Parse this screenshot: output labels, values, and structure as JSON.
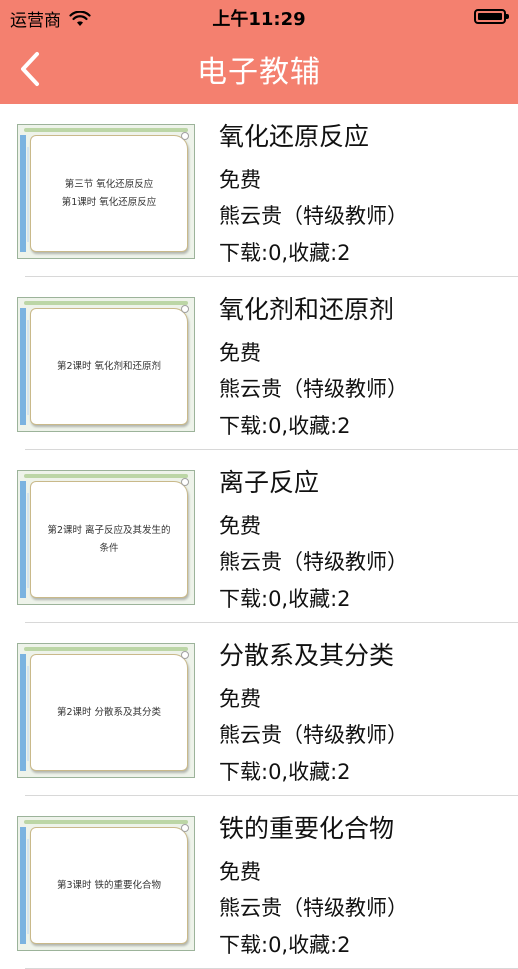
{
  "status_bar": {
    "carrier": "运营商",
    "time": "上午11:29",
    "wifi_icon": "wifi-icon",
    "battery_icon": "battery-icon"
  },
  "nav": {
    "title": "电子教辅",
    "back_icon": "chevron-left-icon"
  },
  "colors": {
    "accent": "#f4806f"
  },
  "items": [
    {
      "title": "氧化还原反应",
      "price": "免费",
      "author": "熊云贵（特级教师）",
      "stats": "下载:0,收藏:2",
      "thumb_lines": [
        "第三节   氧化还原反应",
        "第1课时   氧化还原反应"
      ]
    },
    {
      "title": "氧化剂和还原剂",
      "price": "免费",
      "author": "熊云贵（特级教师）",
      "stats": "下载:0,收藏:2",
      "thumb_lines": [
        "第2课时   氧化剂和还原剂",
        ""
      ]
    },
    {
      "title": "离子反应",
      "price": "免费",
      "author": "熊云贵（特级教师）",
      "stats": "下载:0,收藏:2",
      "thumb_lines": [
        "第2课时   离子反应及其发生的",
        "条件"
      ]
    },
    {
      "title": "分散系及其分类",
      "price": "免费",
      "author": "熊云贵（特级教师）",
      "stats": "下载:0,收藏:2",
      "thumb_lines": [
        "第2课时   分散系及其分类",
        ""
      ]
    },
    {
      "title": "铁的重要化合物",
      "price": "免费",
      "author": "熊云贵（特级教师）",
      "stats": "下载:0,收藏:2",
      "thumb_lines": [
        "第3课时   铁的重要化合物",
        ""
      ]
    }
  ]
}
